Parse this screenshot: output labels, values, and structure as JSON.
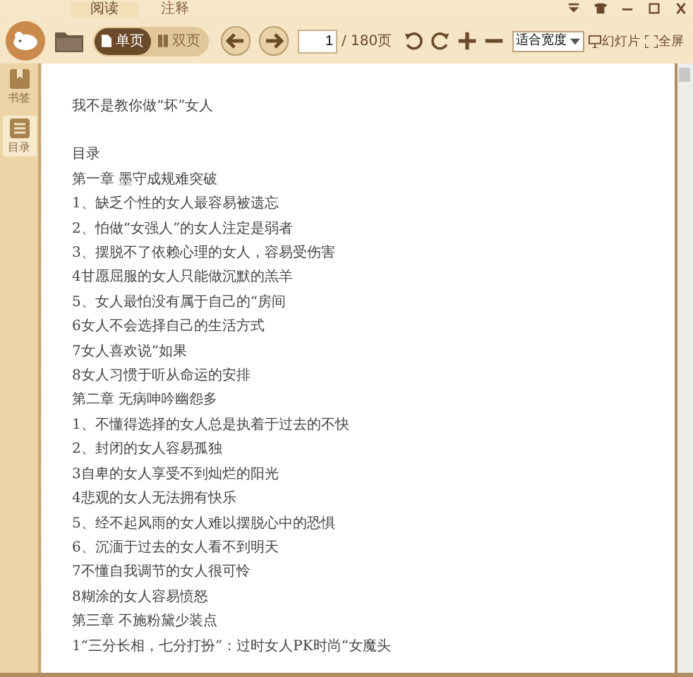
{
  "tabs": [
    {
      "label": "阅读",
      "selected": true
    },
    {
      "label": "注释",
      "selected": false
    }
  ],
  "view_modes": [
    {
      "label": "单页",
      "kind": "single",
      "selected": true
    },
    {
      "label": "双页",
      "kind": "double",
      "selected": false
    }
  ],
  "page": {
    "value": "1",
    "total": "/ 180页"
  },
  "zoom_select": {
    "value": "适合宽度"
  },
  "slideshow": "幻灯片",
  "fullscreen": "全屏",
  "sidebar": [
    {
      "label": "书签",
      "kind": "bookmark",
      "selected": false
    },
    {
      "label": "目录",
      "kind": "toc",
      "selected": true
    }
  ],
  "document": {
    "title": "我不是教你做“坏”女人",
    "lines": [
      "目录",
      "第一章 墨守成规难突破",
      "1、缺乏个性的女人最容易被遗忘",
      "2、怕做“女强人”的女人注定是弱者",
      "3、摆脱不了依赖心理的女人，容易受伤害",
      "4甘愿屈服的女人只能做沉默的羔羊",
      "5、女人最怕没有属于自己的“房间",
      "6女人不会选择自己的生活方式",
      "7女人喜欢说“如果",
      "8女人习惯于听从命运的安排",
      "第二章 无病呻吟幽怨多",
      "1、不懂得选择的女人总是执着于过去的不快",
      "2、封闭的女人容易孤独",
      "3自卑的女人享受不到灿烂的阳光",
      "4悲观的女人无法拥有快乐",
      "5、经不起风雨的女人难以摆脱心中的恐惧",
      "6、沉湎于过去的女人看不到明天",
      "7不懂自我调节的女人很可怜",
      "8糊涂的女人容易愤怒",
      "第三章 不施粉黛少装点",
      "1“三分长相，七分打扮”：过时女人PK时尚“女魔头"
    ]
  }
}
